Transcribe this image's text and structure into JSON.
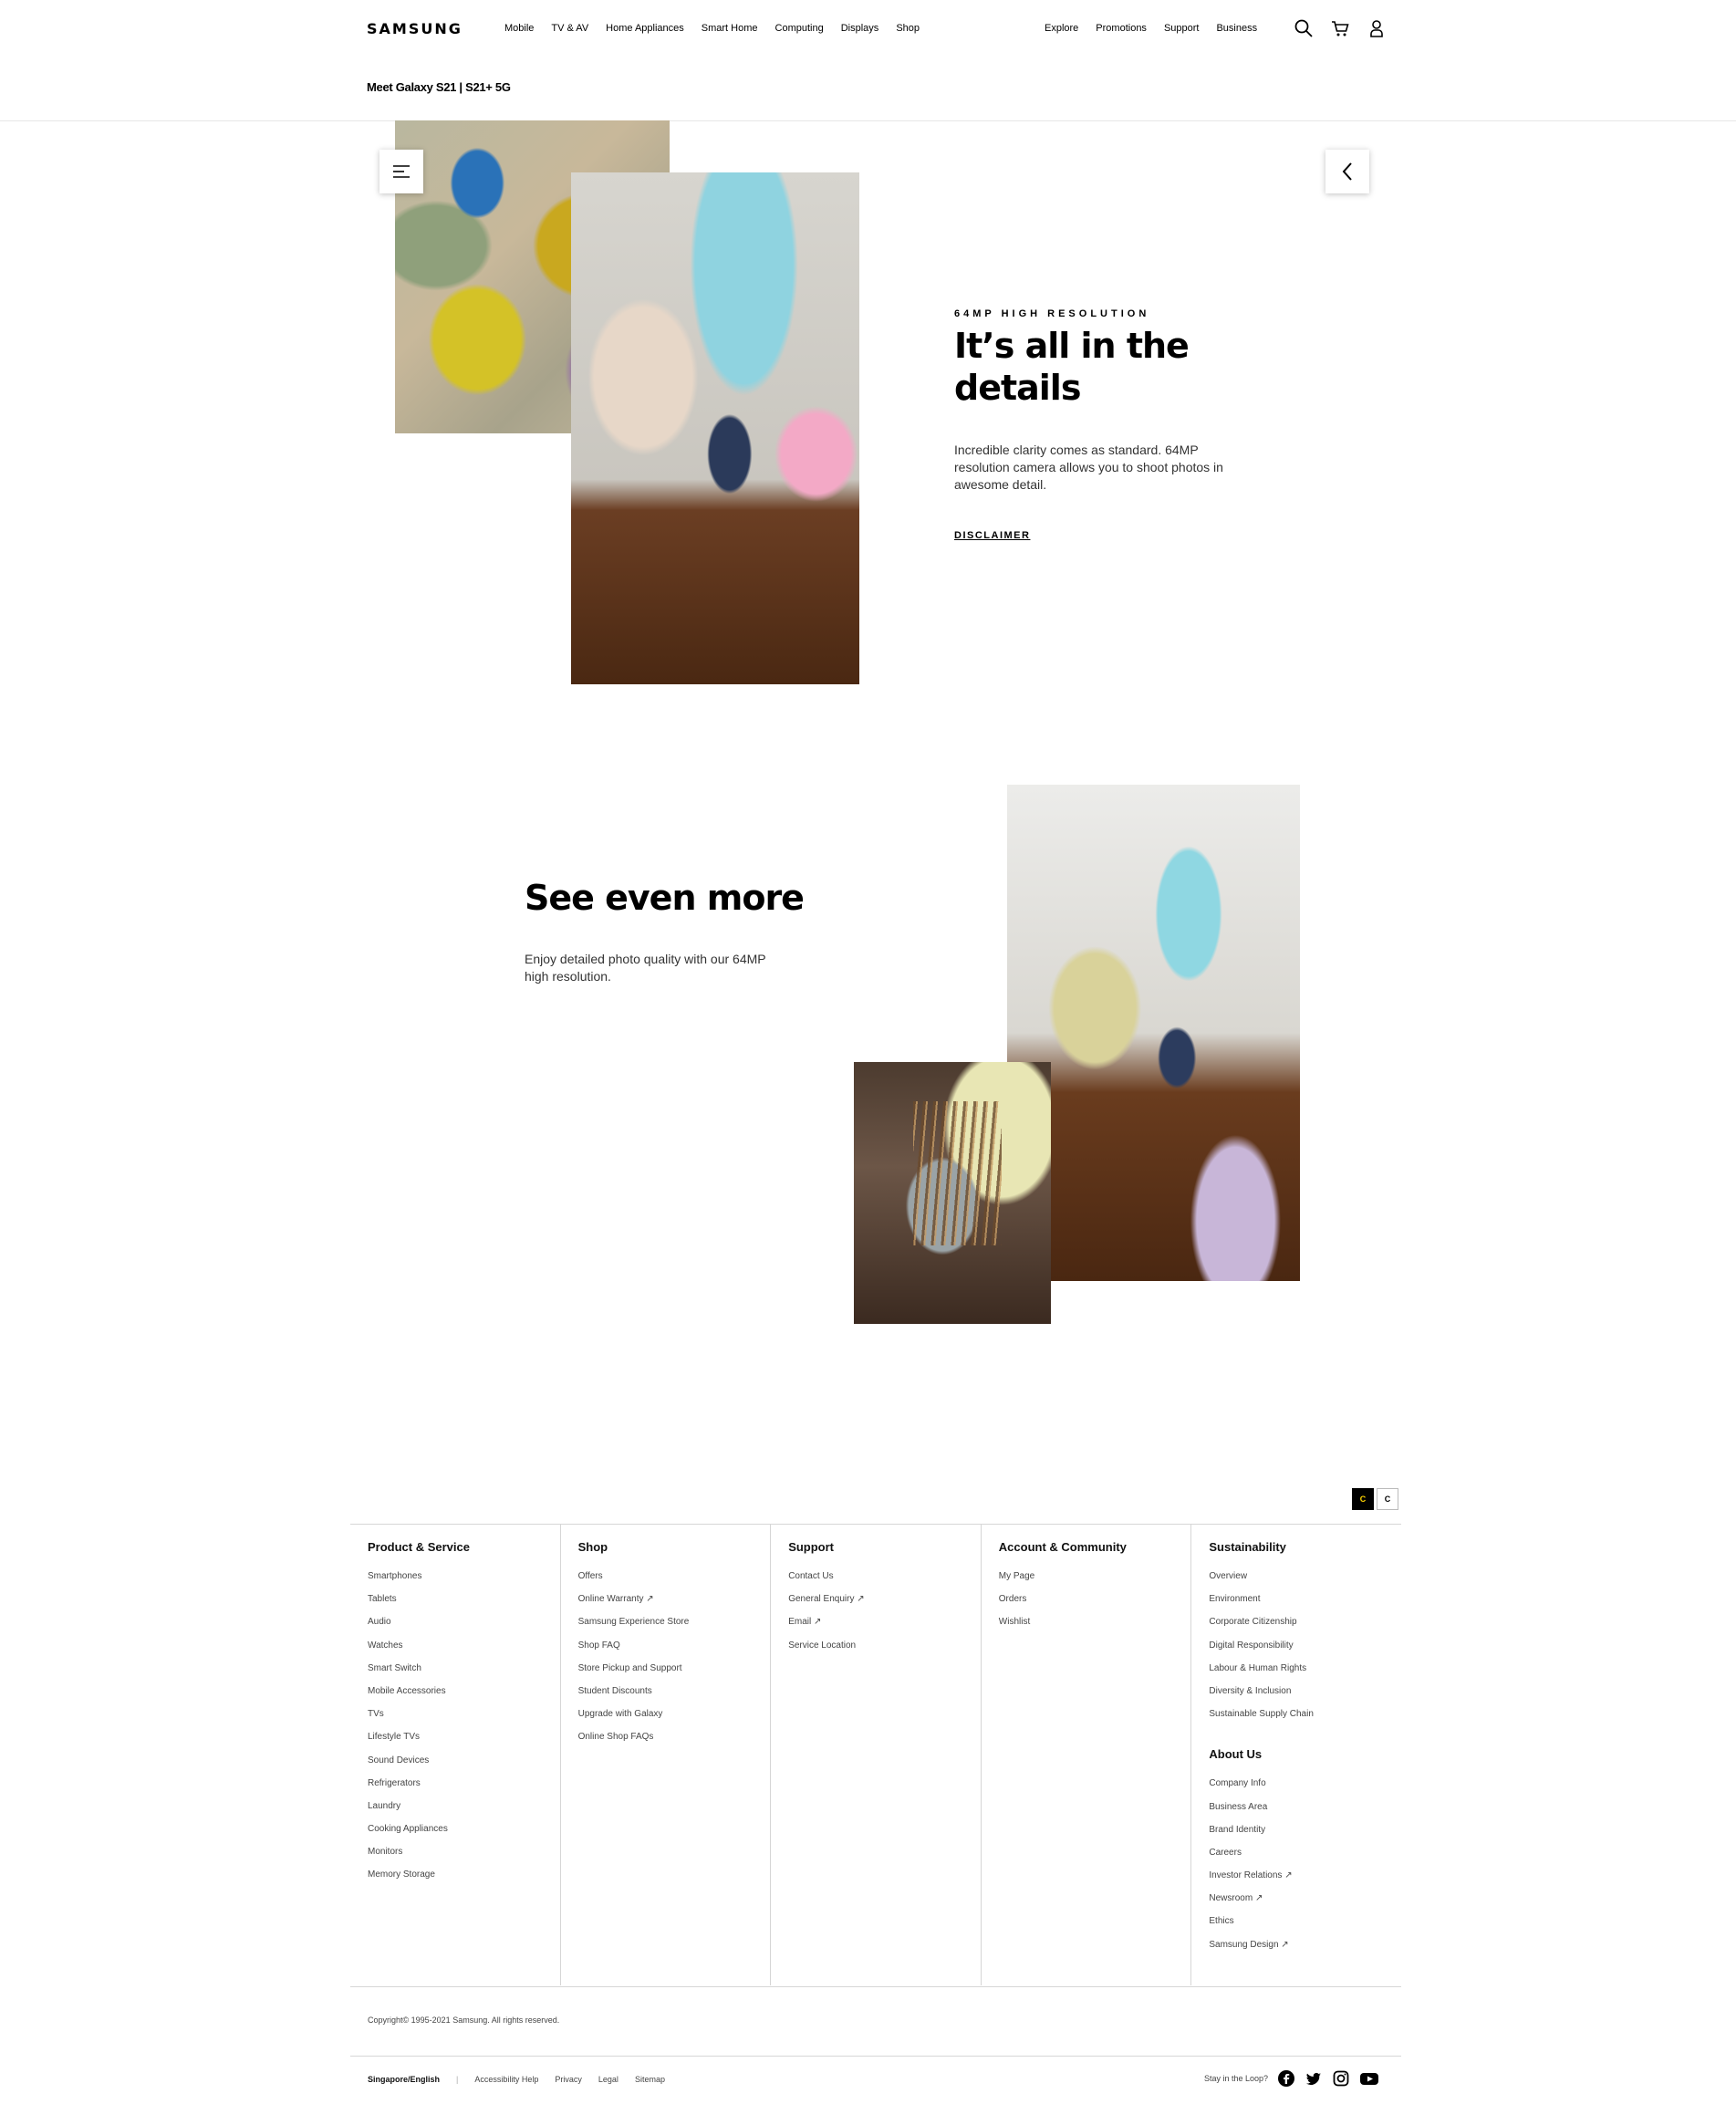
{
  "header": {
    "logo": "SAMSUNG",
    "nav_main": [
      "Mobile",
      "TV & AV",
      "Home Appliances",
      "Smart Home",
      "Computing",
      "Displays",
      "Shop"
    ],
    "nav_util": [
      "Explore",
      "Promotions",
      "Support",
      "Business"
    ],
    "icons": [
      "search-icon",
      "cart-icon",
      "user-icon"
    ]
  },
  "subnav": {
    "title": "Meet Galaxy S21 | S21+ 5G"
  },
  "section1": {
    "eyebrow": "64MP HIGH RESOLUTION",
    "title": "It’s all in the details",
    "description": "Incredible clarity comes as standard. 64MP resolution camera allows you to shoot photos in awesome detail.",
    "disclaimer": "DISCLAIMER"
  },
  "section2": {
    "title": "See even more",
    "description": "Enjoy detailed photo quality with our 64MP high resolution."
  },
  "contrast": {
    "on_label": "C",
    "off_label": "C"
  },
  "footer": {
    "columns": [
      {
        "heading": "Product & Service",
        "items": [
          "Smartphones",
          "Tablets",
          "Audio",
          "Watches",
          "Smart Switch",
          "Mobile Accessories",
          "TVs",
          "Lifestyle TVs",
          "Sound Devices",
          "Refrigerators",
          "Laundry",
          "Cooking Appliances",
          "Monitors",
          "Memory Storage"
        ]
      },
      {
        "heading": "Shop",
        "items": [
          "Offers",
          "Online Warranty ↗",
          "Samsung Experience Store",
          "Shop FAQ",
          "Store Pickup and Support",
          "Student Discounts",
          "Upgrade with Galaxy",
          "Online Shop FAQs"
        ]
      },
      {
        "heading": "Support",
        "items": [
          "Contact Us",
          "General Enquiry ↗",
          "Email ↗",
          "Service Location"
        ]
      },
      {
        "heading": "Account & Community",
        "items": [
          "My Page",
          "Orders",
          "Wishlist"
        ]
      },
      {
        "heading": "Sustainability",
        "items": [
          "Overview",
          "Environment",
          "Corporate Citizenship",
          "Digital Responsibility",
          "Labour & Human Rights",
          "Diversity & Inclusion",
          "Sustainable Supply Chain"
        ],
        "heading2": "About Us",
        "items2": [
          "Company Info",
          "Business Area",
          "Brand Identity",
          "Careers",
          "Investor Relations ↗",
          "Newsroom ↗",
          "Ethics",
          "Samsung Design ↗"
        ]
      }
    ],
    "copyright": "Copyright© 1995-2021 Samsung. All rights reserved.",
    "region": "Singapore/English",
    "bottom_links": [
      "Accessibility Help",
      "Privacy",
      "Legal",
      "Sitemap"
    ],
    "stay_label": "Stay in the Loop?",
    "social": [
      "facebook-icon",
      "twitter-icon",
      "instagram-icon",
      "youtube-icon"
    ]
  }
}
